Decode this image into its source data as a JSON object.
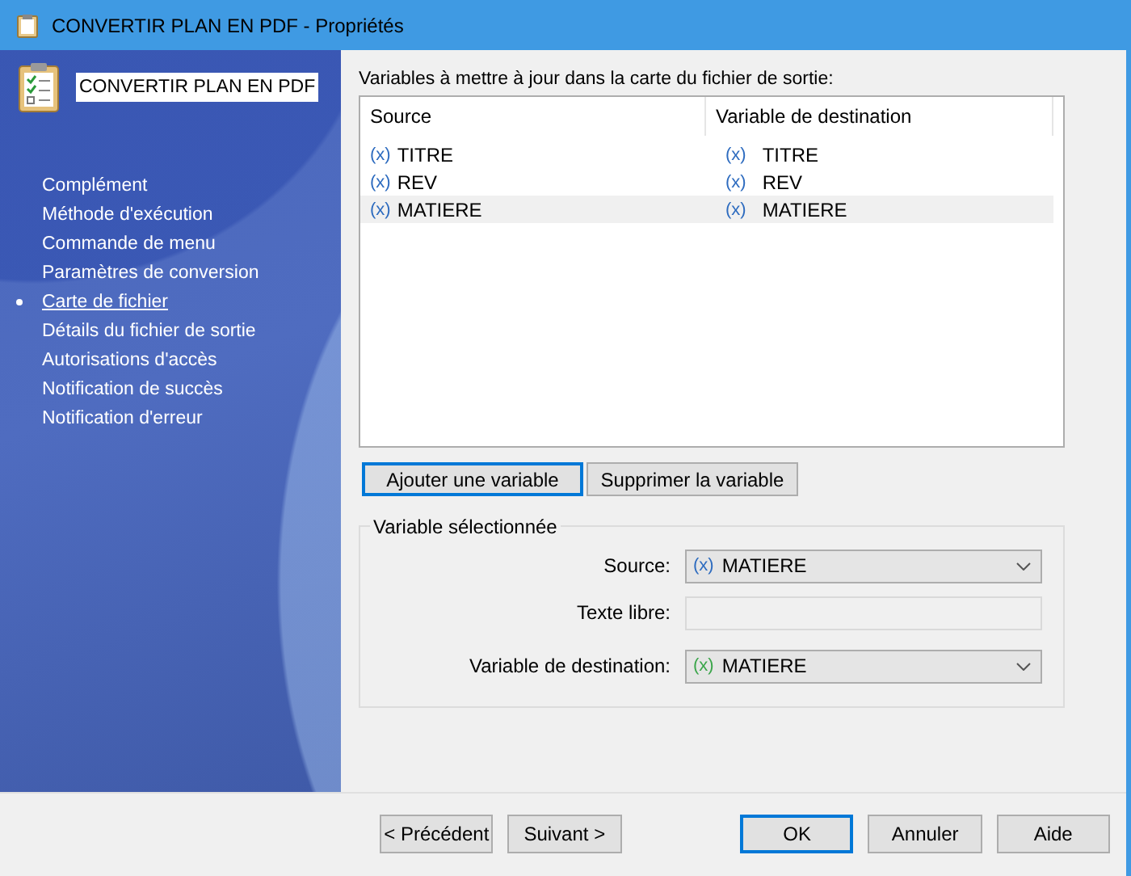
{
  "window": {
    "title": "CONVERTIR PLAN EN PDF - Propriétés"
  },
  "sidebar": {
    "name": "CONVERTIR PLAN EN PDF",
    "items": [
      {
        "label": "Complément",
        "selected": false
      },
      {
        "label": "Méthode d'exécution",
        "selected": false
      },
      {
        "label": "Commande de menu",
        "selected": false
      },
      {
        "label": "Paramètres de conversion",
        "selected": false
      },
      {
        "label": "Carte de fichier",
        "selected": true
      },
      {
        "label": "Détails du fichier de sortie",
        "selected": false
      },
      {
        "label": "Autorisations d'accès",
        "selected": false
      },
      {
        "label": "Notification de succès",
        "selected": false
      },
      {
        "label": "Notification d'erreur",
        "selected": false
      }
    ]
  },
  "variables": {
    "label": "Variables à mettre à jour dans la carte du fichier de sortie:",
    "columns": [
      "Source",
      "Variable de destination"
    ],
    "rows": [
      {
        "source_icon": "(x)",
        "source": "TITRE",
        "dest_icon": "(x)",
        "destination": "TITRE",
        "selected": false
      },
      {
        "source_icon": "(x)",
        "source": "REV",
        "dest_icon": "(x)",
        "destination": "REV",
        "selected": false
      },
      {
        "source_icon": "(x)",
        "source": "MATIERE",
        "dest_icon": "(x)",
        "destination": "MATIERE",
        "selected": true
      }
    ]
  },
  "list_buttons": [
    {
      "label": "Ajouter une variable",
      "focused": true
    },
    {
      "label": "Supprimer la variable",
      "focused": false
    }
  ],
  "selected_variable": {
    "title": "Variable sélectionnée",
    "source": {
      "label": "Source:",
      "icon": "(x)",
      "value": "MATIERE"
    },
    "free_text": {
      "label": "Texte libre:"
    },
    "destination": {
      "label": "Variable de destination:",
      "icon": "(x)",
      "value": "MATIERE"
    }
  },
  "nav_buttons": [
    {
      "label": "< Précédent",
      "focused": false
    },
    {
      "label": "Suivant >",
      "focused": false
    }
  ],
  "dialog_buttons": [
    {
      "label": "OK",
      "focused": true
    },
    {
      "label": "Annuler",
      "focused": false
    },
    {
      "label": "Aide",
      "focused": false
    }
  ]
}
